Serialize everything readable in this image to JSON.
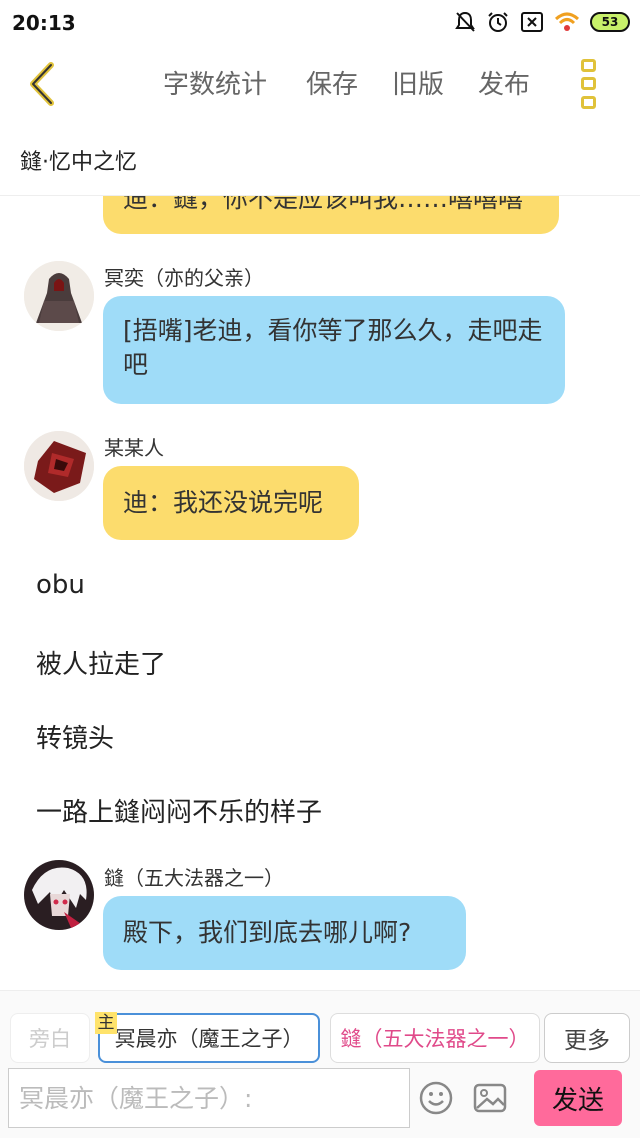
{
  "status_bar": {
    "time": "20:13",
    "battery": "53"
  },
  "toolbar": {
    "word_count": "字数统计",
    "save": "保存",
    "old_version": "旧版",
    "publish": "发布"
  },
  "title": "鏠·忆中之忆",
  "messages": [
    {
      "type": "bubble",
      "color": "yellow",
      "text": "迪：鏠，你不是应该叫我……嘻嘻嘻"
    },
    {
      "type": "speech",
      "speaker": "冥奕（亦的父亲）",
      "color": "blue",
      "text": "[捂嘴]老迪，看你等了那么久，走吧走吧"
    },
    {
      "type": "speech",
      "speaker": "某某人",
      "color": "yellow",
      "text": "迪：我还没说完呢"
    },
    {
      "type": "narration",
      "text": "obu"
    },
    {
      "type": "narration",
      "text": "被人拉走了"
    },
    {
      "type": "narration",
      "text": "转镜头"
    },
    {
      "type": "narration",
      "text": "一路上鏠闷闷不乐的样子"
    },
    {
      "type": "speech",
      "speaker": "鏠（五大法器之一）",
      "color": "blue",
      "text": "殿下，我们到底去哪儿啊?"
    }
  ],
  "roles": {
    "narrator": "旁白",
    "main_tag": "主",
    "main": "冥晨亦（魔王之子）",
    "other": "鏠（五大法器之一）",
    "more": "更多"
  },
  "input": {
    "placeholder": "冥晨亦（魔王之子）:",
    "send": "发送"
  },
  "colors": {
    "yellow_bubble": "#fcdc6d",
    "blue_bubble": "#9fdcf8",
    "accent": "#e0c23a",
    "send": "#ff6a9b"
  }
}
